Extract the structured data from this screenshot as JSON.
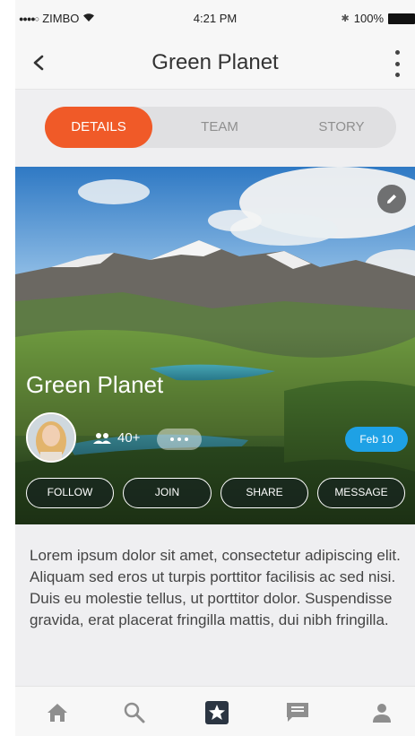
{
  "status_bar": {
    "carrier": "ZIMBO",
    "time": "4:21 PM",
    "battery": "100%"
  },
  "nav": {
    "title": "Green Planet"
  },
  "tabs": [
    {
      "label": "DETAILS",
      "active": true
    },
    {
      "label": "TEAM",
      "active": false
    },
    {
      "label": "STORY",
      "active": false
    }
  ],
  "hero": {
    "title": "Green Planet",
    "members": "40+",
    "date": "Feb 10"
  },
  "actions": {
    "follow": "FOLLOW",
    "join": "JOIN",
    "share": "SHARE",
    "message": "MESSAGE"
  },
  "description": "Lorem ipsum dolor sit amet, consectetur adipiscing elit. Aliquam sed eros ut turpis porttitor facilisis ac sed nisi. Duis eu molestie tellus, ut porttitor dolor. Suspendisse gravida, erat placerat fringilla mattis, dui nibh fringilla.",
  "tab_bar": {
    "items": [
      "home-icon",
      "search-icon",
      "star-icon",
      "chat-icon",
      "profile-icon"
    ],
    "active": "star-icon"
  },
  "colors": {
    "accent": "#f05a28",
    "badge": "#1ea1e5",
    "background": "#efeff1"
  }
}
